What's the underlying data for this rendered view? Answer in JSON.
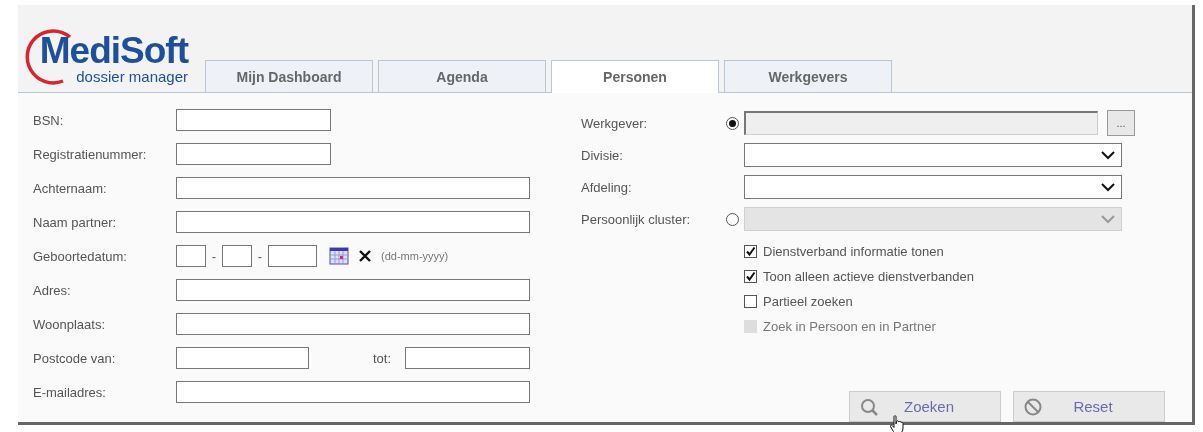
{
  "logo": {
    "name": "MediSoft",
    "tagline": "dossier manager"
  },
  "tabs": [
    {
      "label": "Mijn Dashboard",
      "selected": false
    },
    {
      "label": "Agenda",
      "selected": false
    },
    {
      "label": "Personen",
      "selected": true
    },
    {
      "label": "Werkgevers",
      "selected": false
    }
  ],
  "left_fields": [
    {
      "label": "BSN:",
      "kind": "short"
    },
    {
      "label": "Registratienummer:",
      "kind": "short"
    },
    {
      "label": "Achternaam:",
      "kind": "wide"
    },
    {
      "label": "Naam partner:",
      "kind": "wide"
    },
    {
      "label": "Geboortedatum:",
      "kind": "date",
      "separators": [
        "-",
        "-"
      ],
      "hint": "(dd-mm-yyyy)"
    },
    {
      "label": "Adres:",
      "kind": "wide"
    },
    {
      "label": "Woonplaats:",
      "kind": "wide"
    },
    {
      "label": "Postcode van:",
      "kind": "range",
      "to_label": "tot:"
    },
    {
      "label": "E-mailadres:",
      "kind": "wide"
    }
  ],
  "right_fields": [
    {
      "label": "Werkgever:",
      "kind": "lookup",
      "radio": {
        "selected": true
      },
      "disabled": true,
      "button": "..."
    },
    {
      "label": "Divisie:",
      "kind": "select",
      "disabled": false
    },
    {
      "label": "Afdeling:",
      "kind": "select",
      "disabled": false
    },
    {
      "label": "Persoonlijk cluster:",
      "kind": "select",
      "radio": {
        "selected": false
      },
      "disabled": true
    }
  ],
  "checkboxes": [
    {
      "label": "Dienstverband informatie tonen",
      "checked": true,
      "disabled": false
    },
    {
      "label": "Toon alleen actieve dienstverbanden",
      "checked": true,
      "disabled": false
    },
    {
      "label": "Partieel zoeken",
      "checked": false,
      "disabled": false
    },
    {
      "label": "Zoek in Persoon en in Partner",
      "checked": false,
      "disabled": true
    }
  ],
  "buttons": [
    {
      "label": "Zoeken",
      "kind": "search"
    },
    {
      "label": "Reset",
      "kind": "reset"
    }
  ]
}
